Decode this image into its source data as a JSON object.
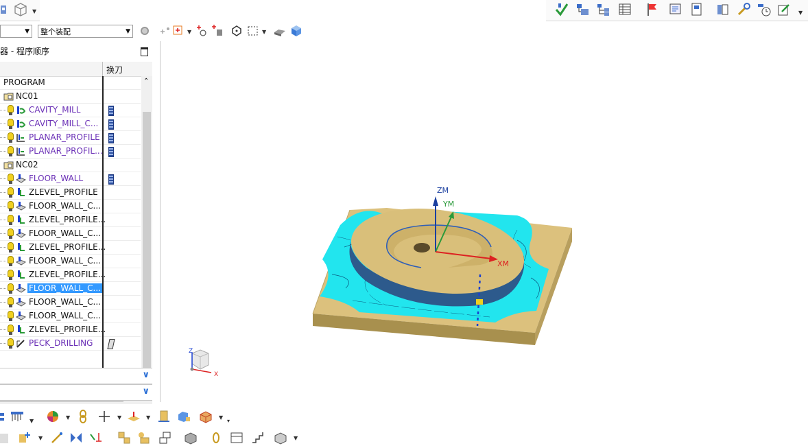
{
  "app": {
    "combo_left_value": "",
    "combo_assembly_value": "整个装配"
  },
  "navigator": {
    "title": "器 - 程序顺序",
    "column_header": "换刀",
    "root": "PROGRAM",
    "rows": [
      {
        "label": "NC01",
        "kind": "group",
        "color": "black",
        "tool": false,
        "selected": false
      },
      {
        "label": "CAVITY_MILL",
        "kind": "cavity",
        "color": "purple",
        "tool": true,
        "selected": false
      },
      {
        "label": "CAVITY_MILL_C...",
        "kind": "cavity",
        "color": "purple",
        "tool": true,
        "selected": false
      },
      {
        "label": "PLANAR_PROFILE",
        "kind": "planar",
        "color": "purple",
        "tool": true,
        "selected": false
      },
      {
        "label": "PLANAR_PROFIL...",
        "kind": "planar",
        "color": "purple",
        "tool": true,
        "selected": false
      },
      {
        "label": "NC02",
        "kind": "group",
        "color": "black",
        "tool": false,
        "selected": false
      },
      {
        "label": "FLOOR_WALL",
        "kind": "floor",
        "color": "purple",
        "tool": true,
        "selected": false
      },
      {
        "label": "ZLEVEL_PROFILE",
        "kind": "zlevel",
        "color": "black",
        "tool": false,
        "selected": false
      },
      {
        "label": "FLOOR_WALL_C...",
        "kind": "floor",
        "color": "black",
        "tool": false,
        "selected": false
      },
      {
        "label": "ZLEVEL_PROFILE...",
        "kind": "zlevel",
        "color": "black",
        "tool": false,
        "selected": false
      },
      {
        "label": "FLOOR_WALL_C...",
        "kind": "floor",
        "color": "black",
        "tool": false,
        "selected": false
      },
      {
        "label": "ZLEVEL_PROFILE...",
        "kind": "zlevel",
        "color": "black",
        "tool": false,
        "selected": false
      },
      {
        "label": "FLOOR_WALL_C...",
        "kind": "floor",
        "color": "black",
        "tool": false,
        "selected": false
      },
      {
        "label": "ZLEVEL_PROFILE...",
        "kind": "zlevel",
        "color": "black",
        "tool": false,
        "selected": false
      },
      {
        "label": "FLOOR_WALL_C...",
        "kind": "floor",
        "color": "black",
        "tool": false,
        "selected": true
      },
      {
        "label": "FLOOR_WALL_C...",
        "kind": "floor",
        "color": "black",
        "tool": false,
        "selected": false
      },
      {
        "label": "FLOOR_WALL_C...",
        "kind": "floor",
        "color": "black",
        "tool": false,
        "selected": false
      },
      {
        "label": "ZLEVEL_PROFILE...",
        "kind": "zlevel",
        "color": "black",
        "tool": false,
        "selected": false
      },
      {
        "label": "PECK_DRILLING",
        "kind": "drill",
        "color": "purple",
        "tool": true,
        "selected": false
      }
    ]
  },
  "viewport": {
    "axis_zm": "ZM",
    "axis_ym": "YM",
    "axis_xm": "XM",
    "triad_z": "Z",
    "triad_x": "X"
  },
  "colors": {
    "selection": "#3399ff",
    "toolpath": "#22e5ee",
    "stock": "#d9bf7a",
    "part_wall": "#2d5a8c",
    "purple_text": "#6a2fb6"
  }
}
